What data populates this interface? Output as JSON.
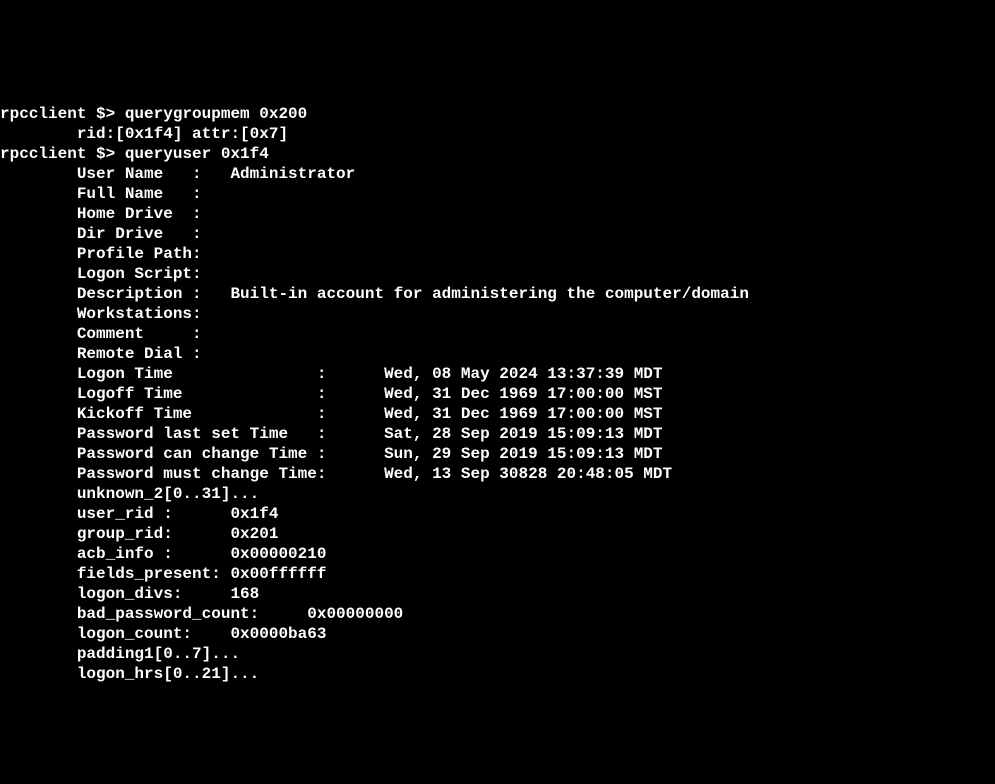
{
  "prompt1": {
    "host": "rpcclient",
    "symbol": " $> ",
    "command": "querygroupmem 0x200"
  },
  "groupmem_result": "        rid:[0x1f4] attr:[0x7]",
  "prompt2": {
    "host": "rpcclient",
    "symbol": " $> ",
    "command": "queryuser 0x1f4"
  },
  "user_info": {
    "l01": "        User Name   :   Administrator",
    "l02": "        Full Name   :",
    "l03": "        Home Drive  :",
    "l04": "        Dir Drive   :",
    "l05": "        Profile Path:",
    "l06": "        Logon Script:",
    "l07": "        Description :   Built-in account for administering the computer/domain",
    "l08": "        Workstations:",
    "l09": "        Comment     :",
    "l10": "        Remote Dial :",
    "l11": "        Logon Time               :      Wed, 08 May 2024 13:37:39 MDT",
    "l12": "        Logoff Time              :      Wed, 31 Dec 1969 17:00:00 MST",
    "l13": "        Kickoff Time             :      Wed, 31 Dec 1969 17:00:00 MST",
    "l14": "        Password last set Time   :      Sat, 28 Sep 2019 15:09:13 MDT",
    "l15": "        Password can change Time :      Sun, 29 Sep 2019 15:09:13 MDT",
    "l16": "        Password must change Time:      Wed, 13 Sep 30828 20:48:05 MDT",
    "l17": "        unknown_2[0..31]...",
    "l18": "        user_rid :      0x1f4",
    "l19": "        group_rid:      0x201",
    "l20": "        acb_info :      0x00000210",
    "l21": "        fields_present: 0x00ffffff",
    "l22": "        logon_divs:     168",
    "l23": "        bad_password_count:     0x00000000",
    "l24": "        logon_count:    0x0000ba63",
    "l25": "        padding1[0..7]...",
    "l26": "        logon_hrs[0..21]..."
  }
}
